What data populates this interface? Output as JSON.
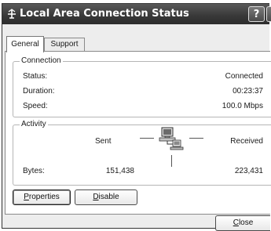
{
  "window": {
    "title": "Local Area Connection Status",
    "help_label": "?",
    "close_label": "X"
  },
  "tabs": [
    {
      "label": "General",
      "active": true
    },
    {
      "label": "Support",
      "active": false
    }
  ],
  "connection": {
    "legend": "Connection",
    "status_label": "Status:",
    "status_value": "Connected",
    "duration_label": "Duration:",
    "duration_value": "00:23:37",
    "speed_label": "Speed:",
    "speed_value": "100.0 Mbps"
  },
  "activity": {
    "legend": "Activity",
    "sent_label": "Sent",
    "received_label": "Received",
    "bytes_label": "Bytes:",
    "bytes_sent": "151,438",
    "bytes_received": "223,431"
  },
  "buttons": {
    "properties": "roperties",
    "properties_mnemonic": "P",
    "disable": "isable",
    "disable_mnemonic": "D",
    "close": "lose",
    "close_mnemonic": "C"
  },
  "icons": {
    "title_icon": "network-connection-icon",
    "activity_icon": "network-computers-icon"
  }
}
